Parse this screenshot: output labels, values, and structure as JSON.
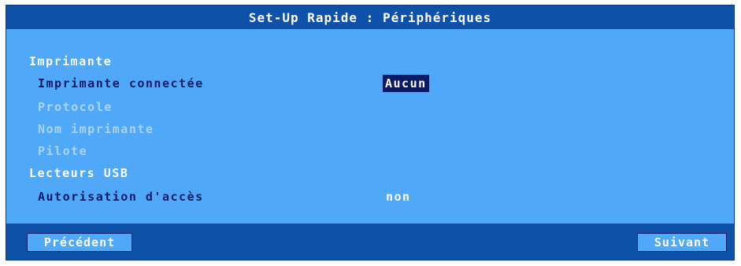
{
  "window": {
    "title": "Set-Up Rapide : Périphériques"
  },
  "sections": {
    "printer": {
      "heading": "Imprimante",
      "connected_label": "Imprimante connectée",
      "connected_value": "Aucun",
      "protocol_label": "Protocole",
      "printer_name_label": "Nom imprimante",
      "driver_label": "Pilote"
    },
    "usb": {
      "heading": "Lecteurs USB",
      "access_label": "Autorisation d'accès",
      "access_value": "non"
    }
  },
  "footer": {
    "previous_label": "Précédent",
    "next_label": "Suivant"
  },
  "colors": {
    "background": "#50a8f8",
    "titlebar": "#0d52a8",
    "selected": "#081a66",
    "disabled_text": "#a9d4fb"
  }
}
